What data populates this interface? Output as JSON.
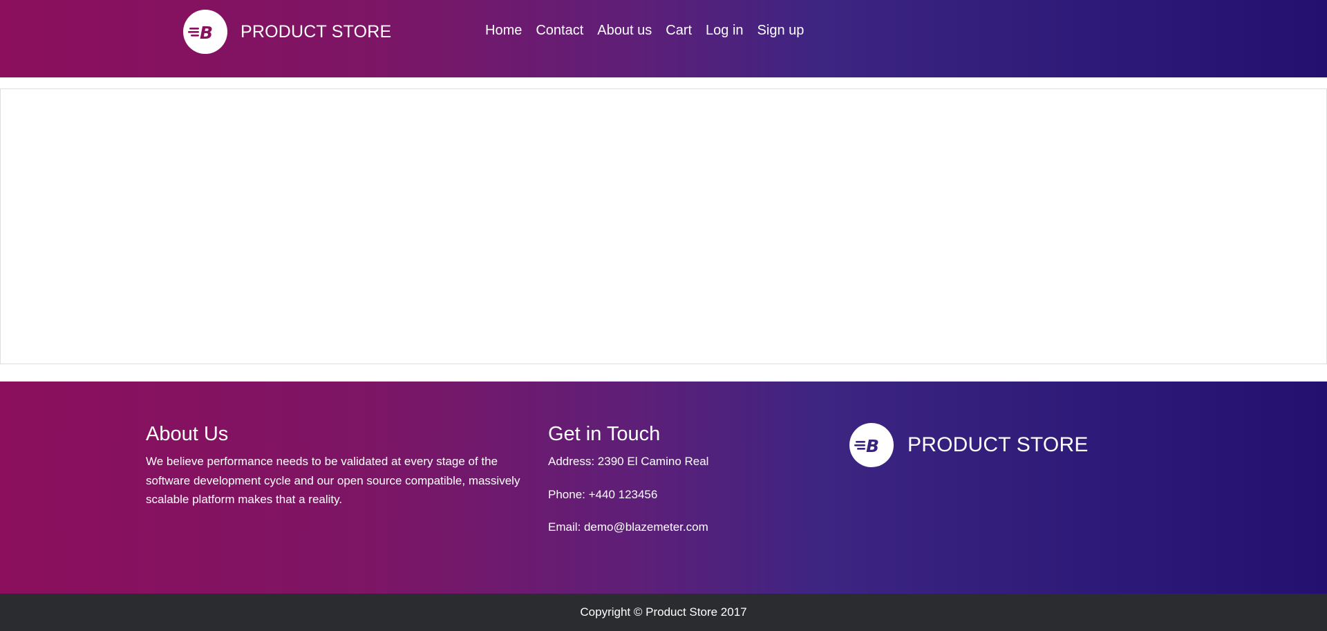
{
  "header": {
    "brand": "PRODUCT STORE",
    "logo_icon": "blazemeter-b-logo",
    "logo_color": "#8b0f5c",
    "nav": [
      {
        "label": "Home"
      },
      {
        "label": "Contact"
      },
      {
        "label": "About us"
      },
      {
        "label": "Cart"
      },
      {
        "label": "Log in"
      },
      {
        "label": "Sign up"
      }
    ]
  },
  "footer": {
    "about": {
      "title": "About Us",
      "text": "We believe performance needs to be validated at every stage of the software development cycle and our open source compatible, massively scalable platform makes that a reality."
    },
    "contact": {
      "title": "Get in Touch",
      "address": "Address: 2390 El Camino Real",
      "phone": "Phone: +440 123456",
      "email": "Email: demo@blazemeter.com"
    },
    "brand": "PRODUCT STORE",
    "logo_icon": "blazemeter-b-logo",
    "logo_color": "#3b2280"
  },
  "copyright": "Copyright © Product Store 2017",
  "colors": {
    "gradient_start": "#8b0f5c",
    "gradient_end": "#24106e",
    "copyright_bg": "#2a2c2f"
  }
}
